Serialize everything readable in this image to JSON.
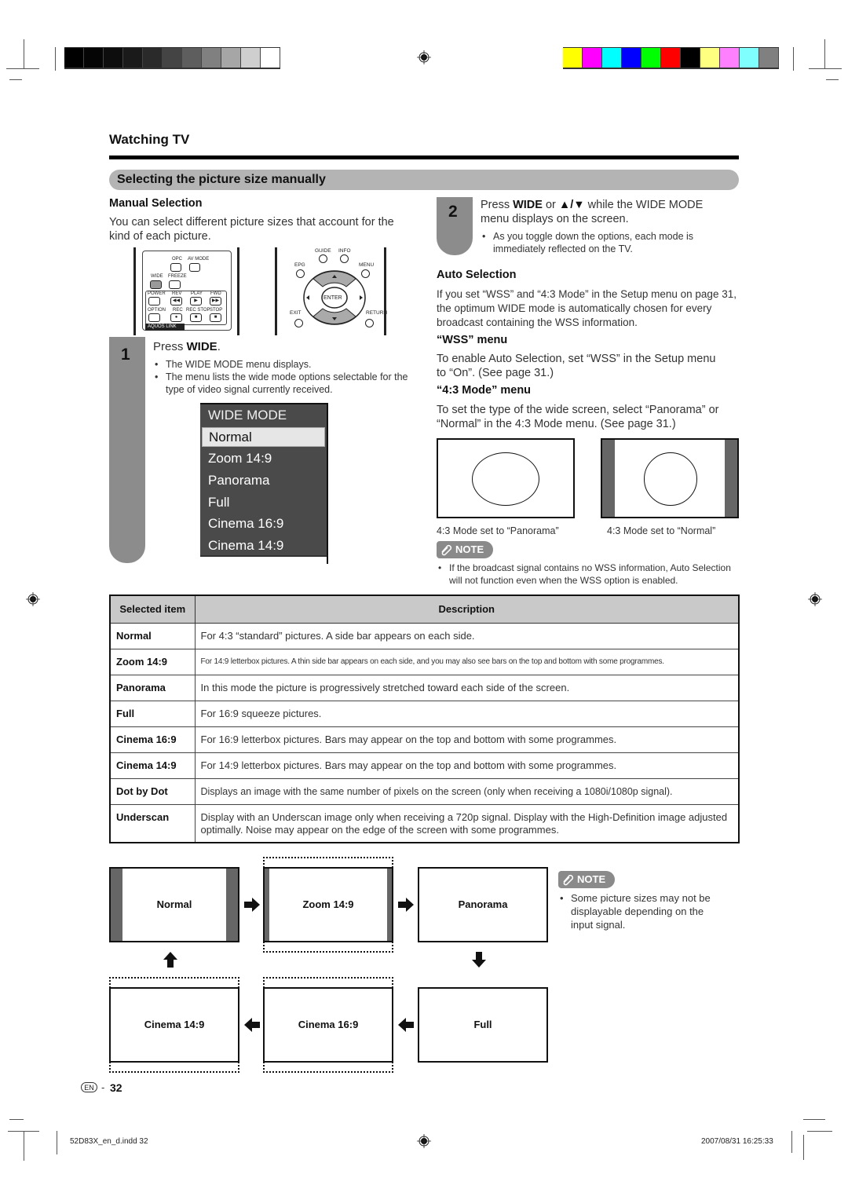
{
  "header": {
    "section_title": "Watching TV",
    "topic_title": "Selecting the picture size manually",
    "grayscale_bars": [
      "#000000",
      "#050505",
      "#0d0d0d",
      "#1a1a1a",
      "#2a2a2a",
      "#444444",
      "#5e5e5e",
      "#808080",
      "#a6a6a6",
      "#cfcfcf",
      "#ffffff"
    ],
    "color_bars": [
      "#ffff00",
      "#ff00ff",
      "#00ffff",
      "#0000ff",
      "#00ff00",
      "#ff0000",
      "#000000",
      "#ffff80",
      "#ff80ff",
      "#80ffff",
      "#808080"
    ]
  },
  "manual_selection": {
    "heading": "Manual Selection",
    "intro": "You can select different picture sizes that account for the kind of each picture.",
    "remote_left": {
      "labels": [
        "OPC",
        "AV MODE",
        "WIDE",
        "FREEZE",
        "POWER",
        "REV",
        "PLAY",
        "FWD",
        "OPTION",
        "REC",
        "REC STOP",
        "STOP"
      ],
      "group_label": "AQUOS LINK"
    },
    "remote_right": {
      "labels": [
        "GUIDE",
        "INFO",
        "EPG",
        "MENU",
        "ENTER",
        "EXIT",
        "RETURN"
      ]
    },
    "step1": {
      "number": "1",
      "instruction_prefix": "Press ",
      "instruction_key": "WIDE",
      "instruction_suffix": ".",
      "bullets": [
        "The WIDE MODE menu displays.",
        "The menu lists the wide mode options selectable for the type of video signal currently received."
      ]
    },
    "wide_mode_menu": {
      "title": "WIDE MODE",
      "selected": "Normal",
      "items": [
        "Zoom 14:9",
        "Panorama",
        "Full",
        "Cinema 16:9",
        "Cinema 14:9"
      ]
    }
  },
  "step2": {
    "number": "2",
    "line_prefix": "Press ",
    "key": "WIDE",
    "line_mid": " or ",
    "arrows": "▲/▼",
    "line_suffix": " while the WIDE MODE menu displays on the screen.",
    "bullet": "As you toggle down the options, each mode is immediately reflected on the TV."
  },
  "auto_selection": {
    "heading": "Auto Selection",
    "text": "If you set “WSS” and “4:3 Mode” in the Setup menu on page 31, the optimum WIDE mode is automatically chosen for every broadcast containing the WSS information.",
    "wss_heading": "“WSS” menu",
    "wss_text": "To enable Auto Selection, set “WSS” in the Setup menu to “On”. (See page 31.)",
    "mode43_heading": "“4:3 Mode” menu",
    "mode43_text": "To set the type of the wide screen, select “Panorama” or “Normal” in the 4:3 Mode menu. (See page 31.)",
    "caption_panorama": "4:3 Mode set to “Panorama”",
    "caption_normal": "4:3 Mode set to “Normal”",
    "note_label": "NOTE",
    "note_text": "If the broadcast signal contains no WSS information, Auto Selection will not function even when the WSS option is enabled."
  },
  "table": {
    "headers": [
      "Selected item",
      "Description"
    ],
    "rows": [
      {
        "item": "Normal",
        "description": "For 4:3 “standard” pictures. A side bar appears on each side."
      },
      {
        "item": "Zoom 14:9",
        "description": "For 14:9 letterbox pictures. A thin side bar appears on each side, and you may also see bars on the top and bottom with some programmes."
      },
      {
        "item": "Panorama",
        "description": "In this mode the picture is progressively stretched toward each side of the screen."
      },
      {
        "item": "Full",
        "description": "For 16:9 squeeze pictures."
      },
      {
        "item": "Cinema 16:9",
        "description": "For 16:9 letterbox pictures. Bars may appear on the top and bottom with some programmes."
      },
      {
        "item": "Cinema 14:9",
        "description": "For 14:9 letterbox pictures. Bars may appear on the top and bottom with some programmes."
      },
      {
        "item": "Dot by Dot",
        "description": "Displays an image with the same number of pixels on the screen (only when receiving a 1080i/1080p signal)."
      },
      {
        "item": "Underscan",
        "description": "Display with an Underscan image only when receiving a 720p signal. Display with the High-Definition image adjusted optimally. Noise may appear on the edge of the screen with some programmes."
      }
    ]
  },
  "flow": {
    "boxes": [
      "Normal",
      "Zoom 14:9",
      "Panorama",
      "Full",
      "Cinema 16:9",
      "Cinema 14:9"
    ],
    "note_label": "NOTE",
    "note_text": "Some picture sizes may not be displayable depending on the input signal."
  },
  "footer": {
    "lang_badge": "EN",
    "page_separator": "-",
    "page_number": "32",
    "file_name": "52D83X_en_d.indd   32",
    "timestamp": "2007/08/31   16:25:33"
  }
}
